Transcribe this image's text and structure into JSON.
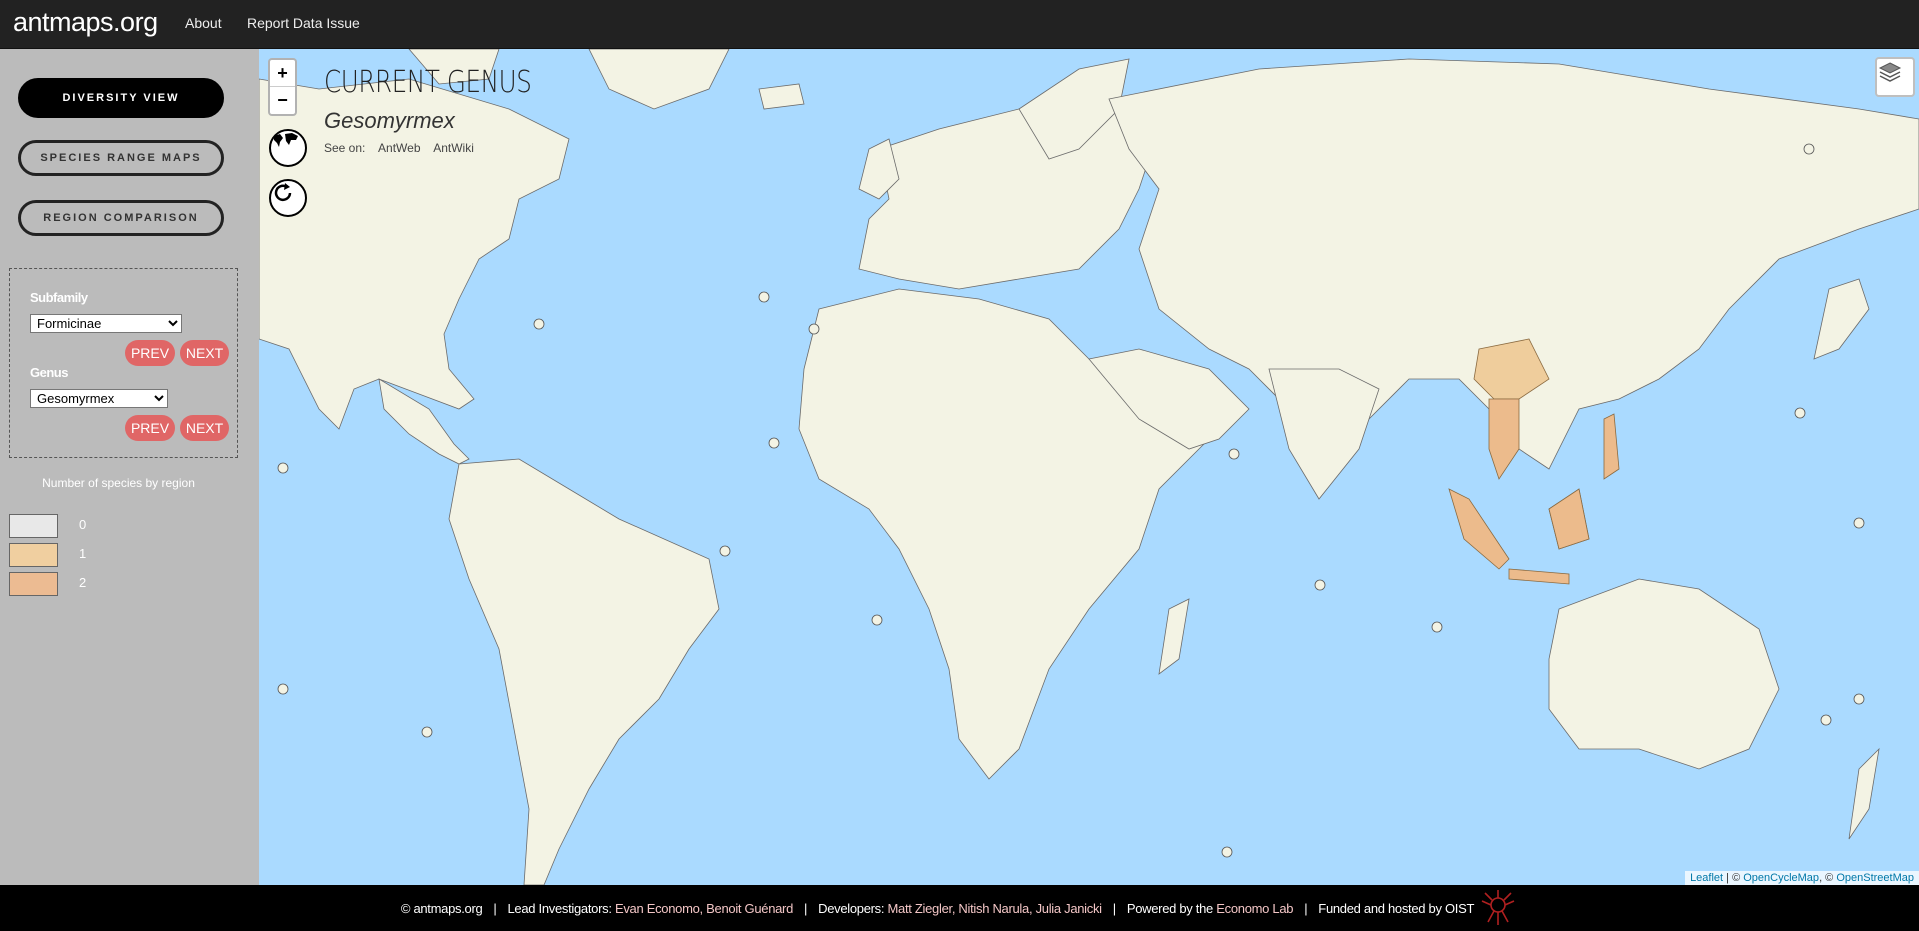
{
  "nav": {
    "brand": "antmaps.org",
    "links": [
      "About",
      "Report Data Issue"
    ]
  },
  "sidebar": {
    "views": [
      "DIVERSITY VIEW",
      "SPECIES RANGE MAPS",
      "REGION COMPARISON"
    ],
    "active_view": "DIVERSITY VIEW",
    "subfamily_label": "Subfamily",
    "subfamily_value": "Formicinae",
    "genus_label": "Genus",
    "genus_value": "Gesomyrmex",
    "prev_label": "PREV",
    "next_label": "NEXT",
    "legend_title": "Number of species by region",
    "legend": [
      {
        "label": "0",
        "color": "#e8e8e8"
      },
      {
        "label": "1",
        "color": "#f0cfa0"
      },
      {
        "label": "2",
        "color": "#ecbb92"
      }
    ]
  },
  "map": {
    "zoom_in": "+",
    "zoom_out": "−",
    "title": "CURRENT GENUS",
    "genus": "Gesomyrmex",
    "see_on_label": "See on:",
    "see_on_links": [
      "AntWeb",
      "AntWiki"
    ],
    "attribution": {
      "leaflet": "Leaflet",
      "sep1": " | © ",
      "ocm": "OpenCycleMap",
      "sep2": ", © ",
      "osm": "OpenStreetMap"
    },
    "colors": {
      "water": "#aadaff",
      "land": "#f3f3e4",
      "highlight": "#efcd9c",
      "highlight_dark": "#ecbb8c"
    }
  },
  "footer": {
    "copyright": "© antmaps.org",
    "lead_label": "Lead Investigators:",
    "lead_names": "Evan Economo, Benoit Guénard",
    "dev_label": "Developers:",
    "dev_names": "Matt Ziegler, Nitish Narula, Julia Janicki",
    "powered_label": "Powered by the",
    "powered_lab": "Economo Lab",
    "funded": "Funded and hosted by OIST",
    "separator": "|"
  }
}
